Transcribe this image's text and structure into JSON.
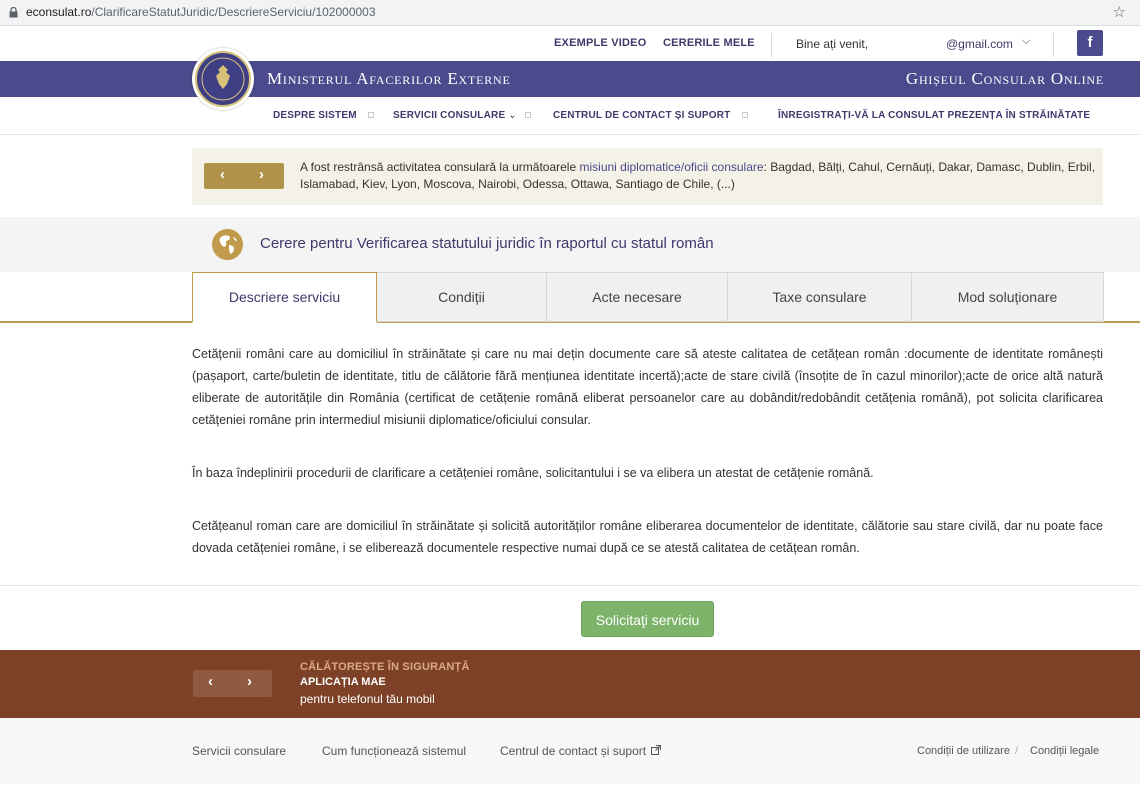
{
  "browser": {
    "url_host": "econsulat.ro",
    "url_path": "/ClarificareStatutJuridic/DescriereServiciu/102000003"
  },
  "topbar": {
    "exemple_video": "EXEMPLE VIDEO",
    "cererile_mele": "CERERILE MELE",
    "welcome": "Bine ați venit,",
    "email": "@gmail.com",
    "facebook": "f"
  },
  "banner": {
    "ministry": "Ministerul Afacerilor Externe",
    "ghiseul": "Ghișeul Consular Online"
  },
  "nav": {
    "items": [
      "DESPRE SISTEM",
      "SERVICII CONSULARE",
      "CENTRUL DE CONTACT ȘI SUPORT",
      "ÎNREGISTRAȚI-VĂ LA CONSULAT PREZENȚA ÎN STRĂINĂTATE"
    ]
  },
  "notice": {
    "prefix": "A fost restrânsă activitatea consulară la următoarele ",
    "link": "misiuni diplomatice/oficii consulare",
    "suffix": ": Bagdad, Bălți, Cahul, Cernăuți, Dakar, Damasc, Dublin, Erbil, Islamabad, Kiev, Lyon, Moscova, Nairobi, Odessa, Ottawa, Santiago de Chile, (...)"
  },
  "page_title": "Cerere pentru Verificarea statutului juridic în raportul cu statul român",
  "tabs": [
    "Descriere serviciu",
    "Condiții",
    "Acte necesare",
    "Taxe consulare",
    "Mod soluționare"
  ],
  "content": {
    "p1": "Cetățenii români care au domiciliul în străinătate și care nu mai dețin documente care să ateste calitatea de cetățean român :documente de identitate românești (pașaport, carte/buletin de identitate, titlu de călătorie fără mențiunea identitate incertă);acte de stare civilă (însoțite de în cazul minorilor);acte de orice altă natură eliberate de autoritățile din România (certificat de cetățenie română eliberat persoanelor care au dobândit/redobândit cetățenia română), pot solicita clarificarea cetățeniei române prin intermediul misiunii diplomatice/oficiului consular.",
    "p2": "În baza îndeplinirii procedurii de clarificare a cetățeniei române, solicitantului i se va elibera un atestat de cetățenie română.",
    "p3": "Cetățeanul roman care are domiciliul în străinătate și solicită autorităților române eliberarea documentelor de identitate, călătorie sau stare civilă, dar nu poate face dovada cetățeniei române, i se eliberează documentele respective numai după ce se atestă calitatea de cetățean român."
  },
  "button": {
    "label": "Solicitaţi serviciu"
  },
  "promo": {
    "line1": "CĂLĂTOREȘTE ÎN SIGURANȚĂ",
    "line2": "APLICAȚIA MAE",
    "line3": "pentru telefonul tău mobil"
  },
  "footer": {
    "left": [
      "Servicii consulare",
      "Cum funcționează sistemul",
      "Centrul de contact și suport"
    ],
    "right": [
      "Condiții de utilizare",
      "/",
      "Condiții legale"
    ]
  },
  "colors": {
    "purple": "#4a4a8c",
    "gold": "#c19a4c",
    "green": "#7db46a",
    "brown": "#7c4127"
  }
}
